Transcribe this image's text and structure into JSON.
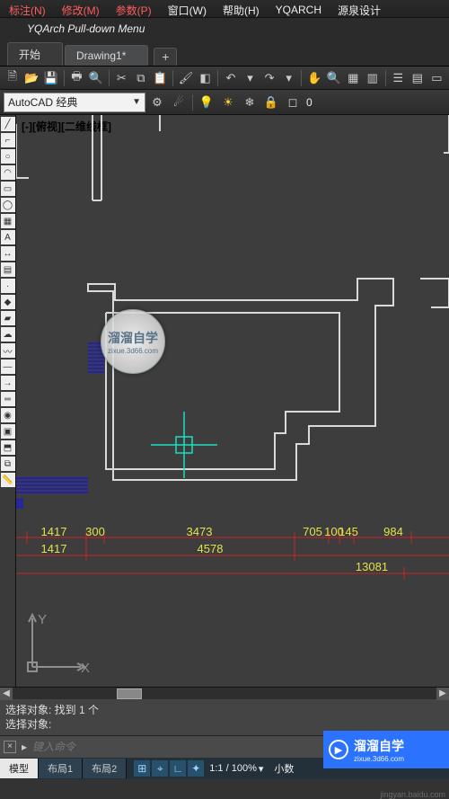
{
  "menu": {
    "items": [
      "标注(N)",
      "修改(M)",
      "参数(P)",
      "窗口(W)",
      "帮助(H)",
      "YQARCH",
      "源泉设计"
    ],
    "pulldown": "YQArch Pull-down Menu"
  },
  "tabs": {
    "items": [
      "开始",
      "Drawing1*"
    ],
    "active": 1,
    "plus": "+"
  },
  "workspace": {
    "combo": "AutoCAD 经典",
    "layer_zero": "0"
  },
  "viewport_label": "[-][俯视][二维线框]",
  "axes": {
    "x_label": "X",
    "y_label": "Y"
  },
  "dimensions_row1": [
    "1417",
    "300",
    "3473",
    "705",
    "100",
    "145",
    "984"
  ],
  "dimensions_row2": [
    "1417",
    "4578"
  ],
  "dimensions_row3": [
    "13081"
  ],
  "command": {
    "history": [
      "选择对象: 找到 1 个",
      "选择对象:"
    ],
    "placeholder": "键入命令",
    "prompt": "▸"
  },
  "layout_tabs": [
    "模型",
    "布局1",
    "布局2"
  ],
  "status": {
    "scale_a": "1:1 / 100%",
    "decimal": "小数"
  },
  "brand": {
    "title": "溜溜自学",
    "url": "zixue.3d66.com"
  },
  "credit": "jingyan.baidu.com",
  "watermark": {
    "title": "溜溜自学",
    "sub": "zixue.3d66.com"
  }
}
